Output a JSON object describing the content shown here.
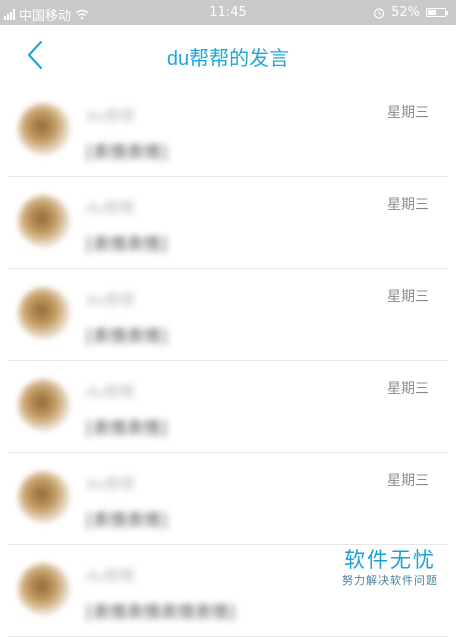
{
  "status_bar": {
    "carrier": "中国移动",
    "time": "11:45",
    "battery": "52%",
    "battery_level": 0.52,
    "icons": [
      "signal-icon",
      "wifi-icon",
      "alarm-icon",
      "battery-icon"
    ]
  },
  "nav": {
    "title": "du帮帮的发言",
    "back_icon": "chevron-left-icon",
    "accent_color": "#22a6d8"
  },
  "messages": [
    {
      "name": "du帮帮",
      "text": "[表情表情]",
      "time": "星期三"
    },
    {
      "name": "du帮帮",
      "text": "[表情表情]",
      "time": "星期三"
    },
    {
      "name": "du帮帮",
      "text": "[表情表情]",
      "time": "星期三"
    },
    {
      "name": "du帮帮",
      "text": "[表情表情]",
      "time": "星期三"
    },
    {
      "name": "du帮帮",
      "text": "[表情表情]",
      "time": "星期三"
    },
    {
      "name": "du帮帮",
      "text": "[表情表情表情表情]",
      "time": ""
    }
  ],
  "watermark": {
    "title": "软件无忧",
    "subtitle": "努力解决软件问题"
  }
}
